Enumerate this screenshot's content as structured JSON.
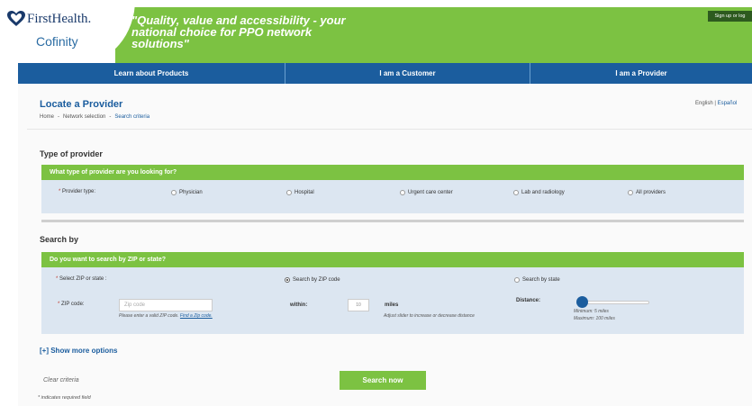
{
  "header": {
    "brand_primary": "FirstHealth.",
    "brand_secondary": "Cofinity",
    "tagline": "\"Quality, value and accessibility - your national choice for PPO network solutions\"",
    "signup_label": "Sign up or log",
    "colors": {
      "green": "#7cc242",
      "navy": "#1b5d9e"
    }
  },
  "nav": {
    "items": [
      {
        "label": "Learn about Products"
      },
      {
        "label": "I am a Customer"
      },
      {
        "label": "I am a Provider"
      }
    ]
  },
  "page": {
    "title": "Locate a Provider",
    "breadcrumb": [
      "Home",
      "-",
      "Network selection",
      "-",
      "Search criteria"
    ],
    "lang_en": "English",
    "lang_sep": "|",
    "lang_es": "Español"
  },
  "provider_type": {
    "heading": "Type of provider",
    "question": "What type of provider are you looking for?",
    "label": "Provider type:",
    "required_mark": "*",
    "options": [
      {
        "label": "Physician",
        "selected": false
      },
      {
        "label": "Hospital",
        "selected": false
      },
      {
        "label": "Urgent care center",
        "selected": false
      },
      {
        "label": "Lab and radiology",
        "selected": false
      },
      {
        "label": "All providers",
        "selected": false
      }
    ]
  },
  "search_by": {
    "heading": "Search by",
    "question": "Do you want to search by ZIP or state?",
    "select_label": "Select ZIP or state :",
    "options": [
      {
        "label": "Search by ZIP code",
        "selected": true
      },
      {
        "label": "Search by state",
        "selected": false
      }
    ],
    "zip_label": "ZIP code:",
    "zip_placeholder": "Zip code",
    "zip_help": "Please enter a valid ZIP code.",
    "zip_help_link": "Find a Zip code.",
    "within_label": "within:",
    "miles_value": "10",
    "miles_label": "miles",
    "slider_help": "Adjust slider to increase or decrease distance",
    "distance_label": "Distance:",
    "distance_min": "Minimum: 5 miles",
    "distance_max": "Maximum: 100 miles",
    "distance_value_fraction": 0.05
  },
  "more_options": "[+] Show more options",
  "actions": {
    "clear": "Clear criteria",
    "search": "Search now"
  },
  "required_note": "* indicates required field"
}
